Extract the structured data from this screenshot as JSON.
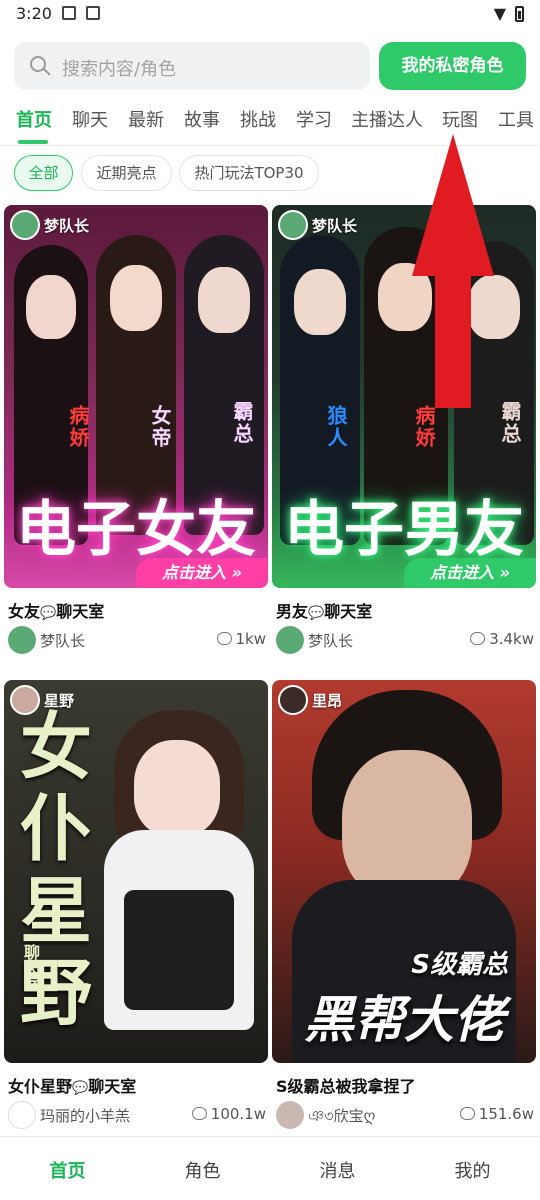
{
  "status": {
    "time": "3:20"
  },
  "search": {
    "placeholder": "搜索内容/角色"
  },
  "my_button": "我的私密角色",
  "tabs": [
    "首页",
    "聊天",
    "最新",
    "故事",
    "挑战",
    "学习",
    "主播达人",
    "玩图",
    "工具"
  ],
  "chips": [
    "全部",
    "近期亮点",
    "热门玩法TOP30"
  ],
  "cards": [
    {
      "author": "梦队长",
      "cover_big": "电子女友",
      "cover_tags": [
        "病娇",
        "女帝",
        "霸总"
      ],
      "enter": "点击进入 »",
      "title": "女友",
      "title_suffix": "聊天室",
      "user": "梦队长",
      "count": "1kw"
    },
    {
      "author": "梦队长",
      "cover_big": "电子男友",
      "cover_tags": [
        "狼人",
        "病娇",
        "霸总"
      ],
      "enter": "点击进入 »",
      "title": "男友",
      "title_suffix": "聊天室",
      "user": "梦队长",
      "count": "3.4kw"
    },
    {
      "author": "星野",
      "cover_big": "女仆星野",
      "cover_tags": [
        "聊天室"
      ],
      "title": "女仆星野",
      "title_suffix": "聊天室",
      "user": "玛丽的小羊羔",
      "count": "100.1w"
    },
    {
      "author": "里昂",
      "cover_big": "黑帮大佬",
      "cover_tags": [
        "S级霸总"
      ],
      "title": "S级霸总被我拿捏了",
      "title_suffix": "",
      "user": "ঞ৩欣宝ღ",
      "count": "151.6w"
    }
  ],
  "bottom_nav": [
    "首页",
    "角色",
    "消息",
    "我的"
  ],
  "colors": {
    "accent": "#2fc96a",
    "arrow": "#e01b22"
  }
}
